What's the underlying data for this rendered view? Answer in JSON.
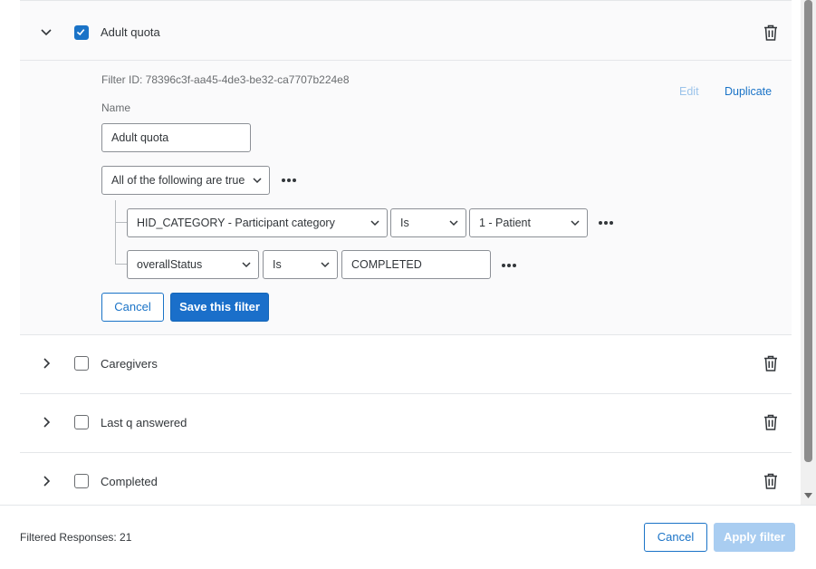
{
  "filters": [
    {
      "label": "Adult quota",
      "checked": true,
      "expanded": true
    },
    {
      "label": "Caregivers",
      "checked": false,
      "expanded": false
    },
    {
      "label": "Last q answered",
      "checked": false,
      "expanded": false
    },
    {
      "label": "Completed",
      "checked": false,
      "expanded": false
    }
  ],
  "editor": {
    "filter_id_text": "Filter ID: 78396c3f-aa45-4de3-be32-ca7707b224e8",
    "edit_label": "Edit",
    "duplicate_label": "Duplicate",
    "name_label": "Name",
    "name_value": "Adult quota",
    "logic_select": "All of the following are true",
    "conditions": [
      {
        "field": "HID_CATEGORY - Participant category",
        "operator": "Is",
        "value": "1 - Patient",
        "value_type": "select"
      },
      {
        "field": "overallStatus",
        "operator": "Is",
        "value": "COMPLETED",
        "value_type": "input"
      }
    ],
    "cancel_label": "Cancel",
    "save_label": "Save this filter"
  },
  "footer": {
    "filtered_responses": "Filtered Responses: 21",
    "cancel_label": "Cancel",
    "apply_label": "Apply filter"
  },
  "colors": {
    "accent": "#1a73c7",
    "accent_disabled": "#a9cdf1",
    "text": "#32363a",
    "muted": "#6a6d70"
  }
}
